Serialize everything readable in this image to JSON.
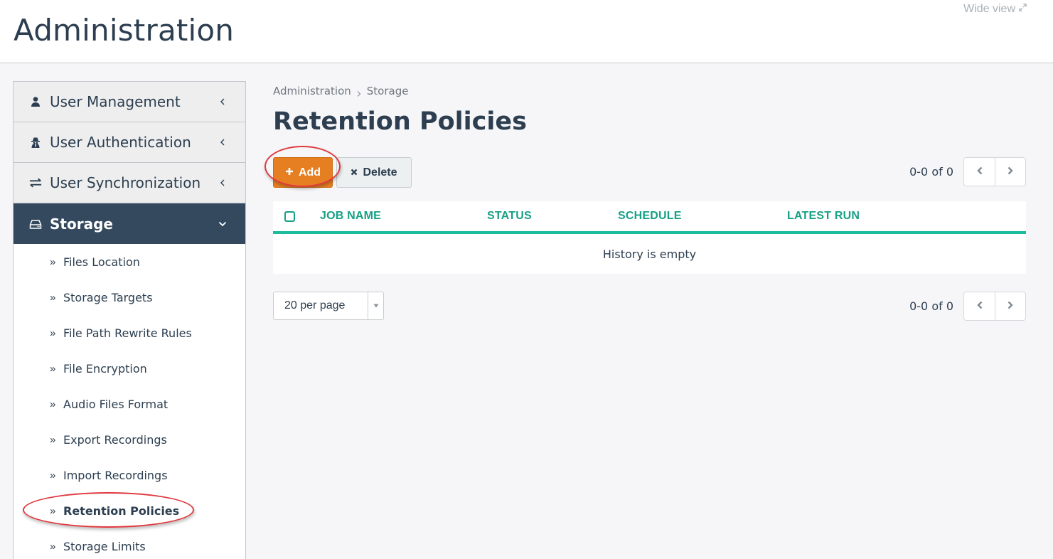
{
  "header": {
    "title": "Administration",
    "wide_view_label": "Wide view",
    "wide_view_icon": "expand-arrows-icon"
  },
  "sidebar": {
    "sections": [
      {
        "label": "User Management",
        "icon": "user-icon",
        "state": "collapsed"
      },
      {
        "label": "User Authentication",
        "icon": "spy-icon",
        "state": "collapsed"
      },
      {
        "label": "User Synchronization",
        "icon": "exchange-icon",
        "state": "collapsed"
      },
      {
        "label": "Storage",
        "icon": "hdd-icon",
        "state": "expanded"
      }
    ],
    "storage_items": [
      {
        "label": "Files Location",
        "active": false
      },
      {
        "label": "Storage Targets",
        "active": false
      },
      {
        "label": "File Path Rewrite Rules",
        "active": false
      },
      {
        "label": "File Encryption",
        "active": false
      },
      {
        "label": "Audio Files Format",
        "active": false
      },
      {
        "label": "Export Recordings",
        "active": false
      },
      {
        "label": "Import Recordings",
        "active": false
      },
      {
        "label": "Retention Policies",
        "active": true
      },
      {
        "label": "Storage Limits",
        "active": false
      }
    ]
  },
  "main": {
    "breadcrumb": [
      "Administration",
      "Storage"
    ],
    "title": "Retention Policies",
    "toolbar": {
      "add_label": "Add",
      "delete_label": "Delete"
    },
    "pagination_top": {
      "range_text": "0-0 of 0"
    },
    "table": {
      "columns": [
        "JOB NAME",
        "STATUS",
        "SCHEDULE",
        "LATEST RUN"
      ],
      "rows": [],
      "empty_text": "History is empty"
    },
    "per_page": {
      "selected": "20 per page"
    },
    "pagination_bottom": {
      "range_text": "0-0 of 0"
    }
  },
  "colors": {
    "accent_orange": "#e67e22",
    "accent_teal": "#1abc9c",
    "header_teal_text": "#16a085",
    "nav_active_bg": "#34495e",
    "annotation_red": "#e0393f"
  }
}
